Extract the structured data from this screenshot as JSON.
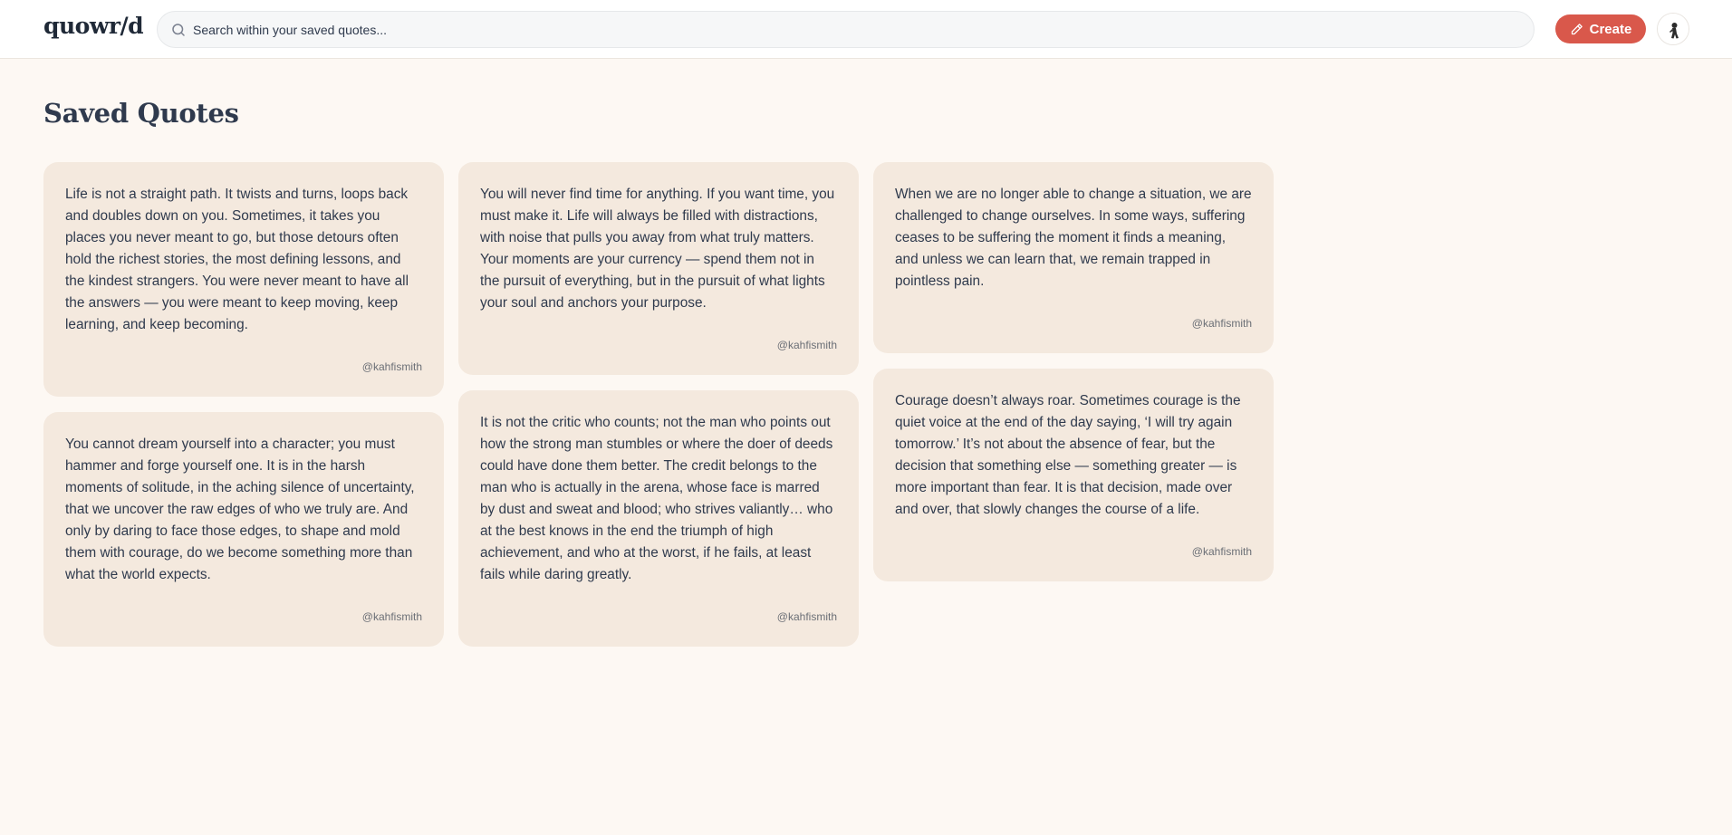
{
  "app": {
    "logo": "quowr/d"
  },
  "search": {
    "placeholder": "Search within your saved quotes..."
  },
  "header": {
    "create_label": "Create"
  },
  "colors": {
    "accent": "#d9584b",
    "card_bg": "#f4e9de",
    "page_bg": "#fdf8f3"
  },
  "icons": {
    "search": "search-icon",
    "create": "pencil-icon",
    "avatar": "avatar"
  },
  "page": {
    "title": "Saved Quotes"
  },
  "quotes": [
    {
      "text": "Life is not a straight path. It twists and turns, loops back and doubles down on you. Sometimes, it takes you places you never meant to go, but those detours often hold the richest stories, the most defining lessons, and the kindest strangers. You were never meant to have all the answers — you were meant to keep moving, keep learning, and keep becoming.",
      "author": "@kahfismith"
    },
    {
      "text": "You will never find time for anything. If you want time, you must make it. Life will always be filled with distractions, with noise that pulls you away from what truly matters. Your moments are your currency — spend them not in the pursuit of everything, but in the pursuit of what lights your soul and anchors your purpose.",
      "author": "@kahfismith"
    },
    {
      "text": "When we are no longer able to change a situation, we are challenged to change ourselves. In some ways, suffering ceases to be suffering the moment it finds a meaning, and unless we can learn that, we remain trapped in pointless pain.",
      "author": "@kahfismith"
    },
    {
      "text": "You cannot dream yourself into a character; you must hammer and forge yourself one. It is in the harsh moments of solitude, in the aching silence of uncertainty, that we uncover the raw edges of who we truly are. And only by daring to face those edges, to shape and mold them with courage, do we become something more than what the world expects.",
      "author": "@kahfismith"
    },
    {
      "text": "It is not the critic who counts; not the man who points out how the strong man stumbles or where the doer of deeds could have done them better. The credit belongs to the man who is actually in the arena, whose face is marred by dust and sweat and blood; who strives valiantly… who at the best knows in the end the triumph of high achievement, and who at the worst, if he fails, at least fails while daring greatly.",
      "author": "@kahfismith"
    },
    {
      "text": "Courage doesn’t always roar. Sometimes courage is the quiet voice at the end of the day saying, ‘I will try again tomorrow.’ It’s not about the absence of fear, but the decision that something else — something greater — is more important than fear. It is that decision, made over and over, that slowly changes the course of a life.",
      "author": "@kahfismith"
    }
  ]
}
